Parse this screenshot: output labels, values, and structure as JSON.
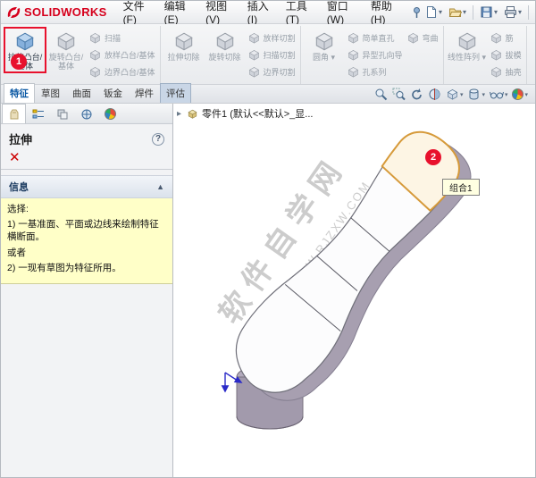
{
  "colors": {
    "brand_red": "#d6001c",
    "annotation_red": "#e8112d",
    "message_yellow": "#ffffc8",
    "selection_orange": "#d69a3a",
    "model_side_gray": "#a79fb0"
  },
  "menubar": {
    "logo_text": "SOLIDWORKS",
    "menus": [
      {
        "label": "文件(F)",
        "name": "menu-file"
      },
      {
        "label": "编辑(E)",
        "name": "menu-edit"
      },
      {
        "label": "视图(V)",
        "name": "menu-view"
      },
      {
        "label": "插入(I)",
        "name": "menu-insert"
      },
      {
        "label": "工具(T)",
        "name": "menu-tools"
      },
      {
        "label": "窗口(W)",
        "name": "menu-window"
      },
      {
        "label": "帮助(H)",
        "name": "menu-help"
      }
    ],
    "icons": [
      "new-document-icon",
      "open-document-icon",
      "save-icon",
      "print-icon"
    ]
  },
  "ribbon": {
    "groups": [
      {
        "columns": [
          {
            "type": "big",
            "buttons": [
              {
                "label": "拉伸凸台/基体",
                "icon": "extruded-boss-icon",
                "enabled": true,
                "highlighted": true
              }
            ]
          },
          {
            "type": "big",
            "buttons": [
              {
                "label": "旋转凸台/基体",
                "icon": "revolved-boss-icon"
              }
            ]
          },
          {
            "type": "stack",
            "buttons": [
              {
                "label": "扫描",
                "icon": "swept-boss-icon"
              },
              {
                "label": "放样凸台/基体",
                "icon": "lofted-boss-icon"
              },
              {
                "label": "边界凸台/基体",
                "icon": "boundary-boss-icon"
              }
            ]
          }
        ]
      },
      {
        "columns": [
          {
            "type": "big",
            "buttons": [
              {
                "label": "拉伸切除",
                "icon": "extruded-cut-icon"
              }
            ]
          },
          {
            "type": "big",
            "buttons": [
              {
                "label": "旋转切除",
                "icon": "revolved-cut-icon"
              }
            ]
          },
          {
            "type": "stack",
            "buttons": [
              {
                "label": "放样切割",
                "icon": "lofted-cut-icon"
              },
              {
                "label": "扫描切割",
                "icon": "swept-cut-icon"
              },
              {
                "label": "边界切割",
                "icon": "boundary-cut-icon"
              }
            ]
          }
        ]
      },
      {
        "columns": [
          {
            "type": "big",
            "buttons": [
              {
                "label": "圆角",
                "icon": "fillet-icon",
                "caret": true
              }
            ]
          },
          {
            "type": "stack",
            "buttons": [
              {
                "label": "简单直孔",
                "icon": "simple-hole-icon"
              },
              {
                "label": "异型孔向导",
                "icon": "hole-wizard-icon"
              },
              {
                "label": "孔系列",
                "icon": "hole-series-icon"
              }
            ]
          },
          {
            "type": "stack",
            "buttons": [
              {
                "label": "弯曲",
                "icon": "flex-icon"
              }
            ]
          }
        ]
      },
      {
        "columns": [
          {
            "type": "big",
            "buttons": [
              {
                "label": "线性阵列",
                "icon": "linear-pattern-icon",
                "caret": true
              }
            ]
          },
          {
            "type": "stack",
            "buttons": [
              {
                "label": "筋",
                "icon": "rib-icon"
              },
              {
                "label": "拔模",
                "icon": "draft-icon"
              },
              {
                "label": "抽壳",
                "icon": "shell-icon"
              }
            ]
          }
        ]
      }
    ]
  },
  "tabs": [
    {
      "label": "特征",
      "name": "tab-features",
      "state": "active"
    },
    {
      "label": "草图",
      "name": "tab-sketch",
      "state": "normal"
    },
    {
      "label": "曲面",
      "name": "tab-surfaces",
      "state": "normal"
    },
    {
      "label": "钣金",
      "name": "tab-sheet-metal",
      "state": "normal"
    },
    {
      "label": "焊件",
      "name": "tab-weldments",
      "state": "normal"
    },
    {
      "label": "评估",
      "name": "tab-evaluate",
      "state": "toggled"
    }
  ],
  "headsup_icons": [
    "zoom-fit-icon",
    "zoom-area-icon",
    "previous-view-icon",
    "section-view-icon",
    "view-orientation-icon",
    "display-style-icon",
    "hide-show-items-icon",
    "edit-appearance-icon"
  ],
  "pm_tabs": [
    "property-manager-tab",
    "feature-manager-tab",
    "configuration-manager-tab",
    "dimxpert-manager-tab",
    "display-manager-tab"
  ],
  "property_manager": {
    "title": "拉伸",
    "help_icon": "?",
    "cancel_icon": "✕",
    "section_header": "信息",
    "collapse_icon": "▲",
    "message": {
      "lines": [
        "选择:",
        "1) 一基准面、平面或边线来绘制特征横断面。",
        "或者",
        "2) 一现有草图为特征所用。"
      ]
    }
  },
  "viewport": {
    "tree_item": "零件1 (默认<<默认>_显...",
    "flyout_icon": "▸",
    "tooltip": "组合1",
    "watermark_line1": "软件自学网",
    "watermark_line2": "WWW.RJZXW.COM"
  },
  "annotations": {
    "step1": "1",
    "step2": "2"
  }
}
